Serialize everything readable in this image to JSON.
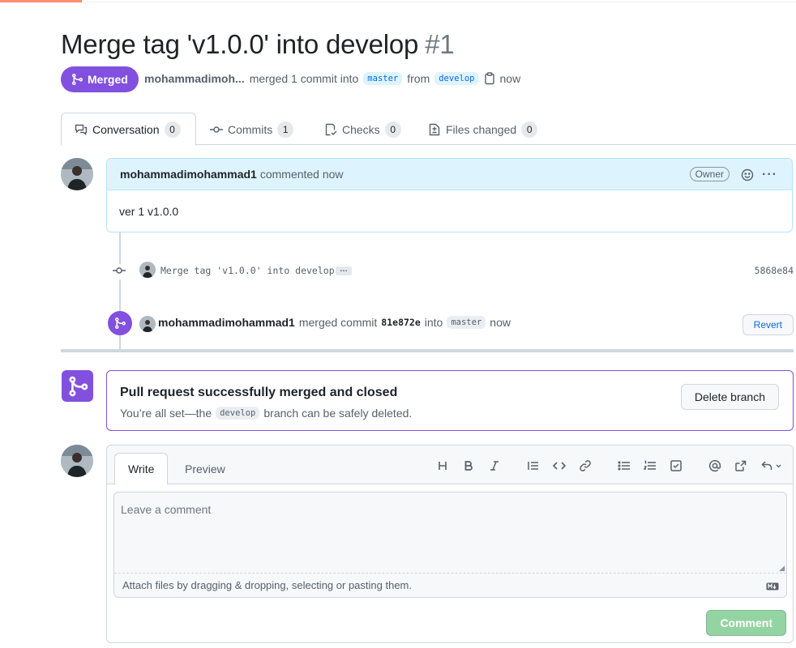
{
  "pr": {
    "title": "Merge tag 'v1.0.0' into develop",
    "number": "#1",
    "state_label": "Merged",
    "author": "mohammadimoh...",
    "merged_text": "merged 1 commit into",
    "base_branch": "master",
    "from_text": "from",
    "head_branch": "develop",
    "time": "now"
  },
  "tabs": [
    {
      "label": "Conversation",
      "count": "0"
    },
    {
      "label": "Commits",
      "count": "1"
    },
    {
      "label": "Checks",
      "count": "0"
    },
    {
      "label": "Files changed",
      "count": "0"
    }
  ],
  "comment": {
    "author": "mohammadimohammad1",
    "action": "commented now",
    "badge": "Owner",
    "body": "ver 1 v1.0.0"
  },
  "commit": {
    "message": "Merge tag 'v1.0.0' into develop",
    "ellipsis": "…",
    "sha": "5868e84"
  },
  "merge_event": {
    "author": "mohammadimohammad1",
    "text": "merged commit",
    "sha": "81e872e",
    "into": "into",
    "branch": "master",
    "time": "now",
    "revert_label": "Revert"
  },
  "merged_box": {
    "heading": "Pull request successfully merged and closed",
    "sub_before": "You’re all set—the",
    "branch": "develop",
    "sub_after": "branch can be safely deleted.",
    "delete_label": "Delete branch"
  },
  "editor": {
    "write_tab": "Write",
    "preview_tab": "Preview",
    "placeholder": "Leave a comment",
    "attach_text": "Attach files by dragging & dropping, selecting or pasting them.",
    "submit_label": "Comment",
    "toolbar_icons": [
      "heading-icon",
      "bold-icon",
      "italic-icon",
      "quote-icon",
      "code-icon",
      "link-icon",
      "unordered-list-icon",
      "ordered-list-icon",
      "task-list-icon",
      "mention-icon",
      "cross-reference-icon",
      "saved-replies-icon"
    ]
  },
  "colors": {
    "merged_purple": "#8250df",
    "link_blue": "#0969da",
    "comment_header_bg": "#ddf4ff",
    "comment_btn_disabled": "#94d3a2"
  }
}
